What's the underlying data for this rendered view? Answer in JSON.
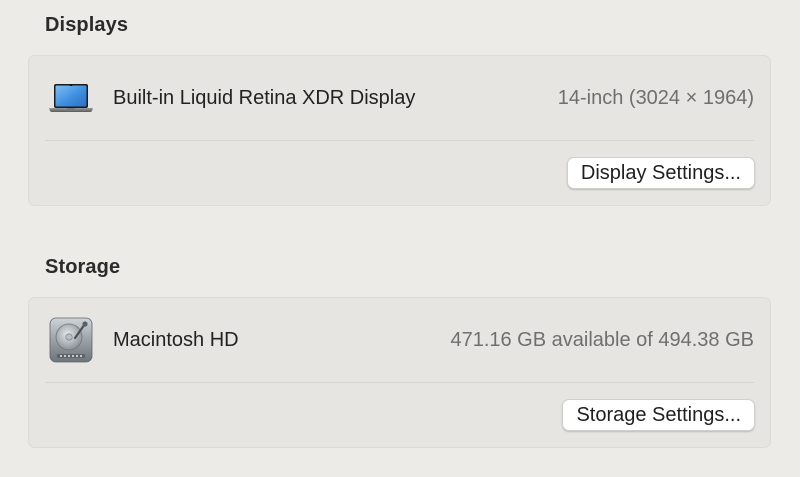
{
  "displays": {
    "section_title": "Displays",
    "items": [
      {
        "icon": "laptop-icon",
        "name": "Built-in Liquid Retina XDR Display",
        "detail": "14-inch (3024 × 1964)"
      }
    ],
    "settings_button": "Display Settings..."
  },
  "storage": {
    "section_title": "Storage",
    "items": [
      {
        "icon": "hard-drive-icon",
        "name": "Macintosh HD",
        "detail": "471.16 GB available of 494.38 GB"
      }
    ],
    "settings_button": "Storage Settings..."
  }
}
